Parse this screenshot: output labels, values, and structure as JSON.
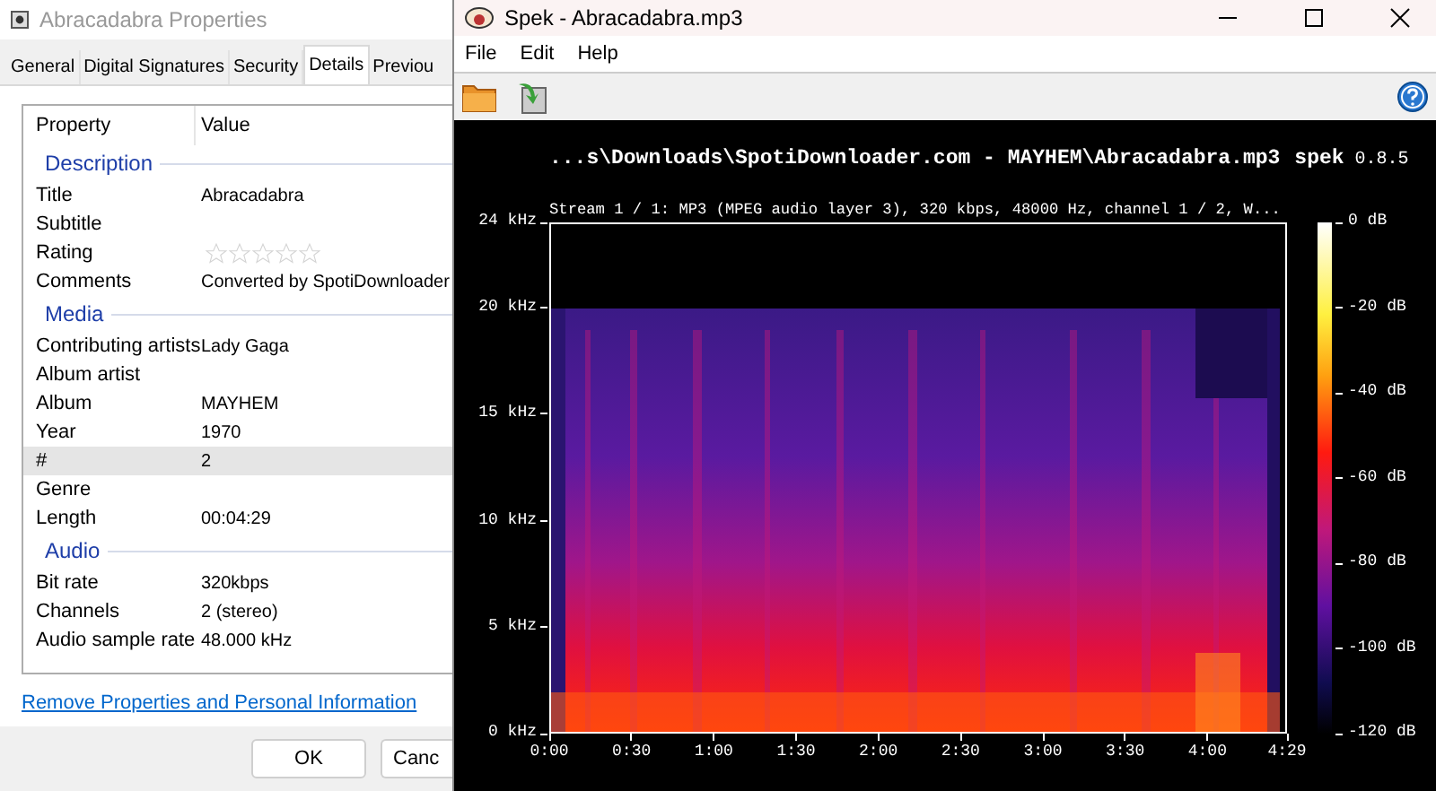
{
  "properties_window": {
    "title": "Abracadabra Properties",
    "tabs": [
      {
        "label": "General",
        "selected": false
      },
      {
        "label": "Digital Signatures",
        "selected": false
      },
      {
        "label": "Security",
        "selected": false
      },
      {
        "label": "Details",
        "selected": true
      },
      {
        "label": "Previou",
        "selected": false
      }
    ],
    "columns": [
      "Property",
      "Value"
    ],
    "groups": [
      {
        "name": "Description",
        "rows": [
          {
            "kind": "text",
            "property": "Title",
            "value": "Abracadabra",
            "selected": false
          },
          {
            "kind": "text",
            "property": "Subtitle",
            "selected": false
          },
          {
            "kind": "stars",
            "property": "Rating",
            "stars": 0,
            "selected": false
          },
          {
            "kind": "text",
            "property": "Comments",
            "value": "Converted by SpotiDownloader",
            "selected": false
          }
        ]
      },
      {
        "name": "Media",
        "rows": [
          {
            "kind": "text",
            "property": "Contributing artists",
            "value": "Lady Gaga",
            "selected": false
          },
          {
            "kind": "text",
            "property": "Album artist",
            "selected": false
          },
          {
            "kind": "text",
            "property": "Album",
            "value": "MAYHEM",
            "selected": false
          },
          {
            "kind": "text",
            "property": "Year",
            "value": "1970",
            "selected": false
          },
          {
            "kind": "text",
            "property": "#",
            "value": "2",
            "selected": true
          },
          {
            "kind": "text",
            "property": "Genre",
            "selected": false
          },
          {
            "kind": "text",
            "property": "Length",
            "value": "00:04:29",
            "selected": false
          }
        ]
      },
      {
        "name": "Audio",
        "rows": [
          {
            "kind": "text",
            "property": "Bit rate",
            "value": "320kbps",
            "selected": false
          },
          {
            "kind": "text",
            "property": "Channels",
            "value": "2 (stereo)",
            "selected": false
          },
          {
            "kind": "text",
            "property": "Audio sample rate",
            "value": "48.000 kHz",
            "selected": false
          }
        ]
      }
    ],
    "link": "Remove Properties and Personal Information",
    "buttons": [
      "OK",
      "Canc"
    ]
  },
  "spek_window": {
    "title": "Spek - Abracadabra.mp3",
    "menu": [
      "File",
      "Edit",
      "Help"
    ],
    "file_path": "...s\\Downloads\\SpotiDownloader.com - MAYHEM\\Abracadabra.mp3",
    "app_name": "spek",
    "version": "0.8.5",
    "stream_info": "Stream 1 / 1: MP3 (MPEG audio layer 3), 320 kbps, 48000 Hz, channel 1 / 2, W...",
    "frequency_ticks": [
      "24 kHz",
      "20 kHz",
      "15 kHz",
      "10 kHz",
      "5 kHz",
      "0 kHz"
    ],
    "time_ticks": [
      "0:00",
      "0:30",
      "1:00",
      "1:30",
      "2:00",
      "2:30",
      "3:00",
      "3:30",
      "4:00",
      "4:29"
    ],
    "db_ticks": [
      "0 dB",
      "-20 dB",
      "-40 dB",
      "-60 dB",
      "-80 dB",
      "-100 dB",
      "-120 dB"
    ]
  }
}
